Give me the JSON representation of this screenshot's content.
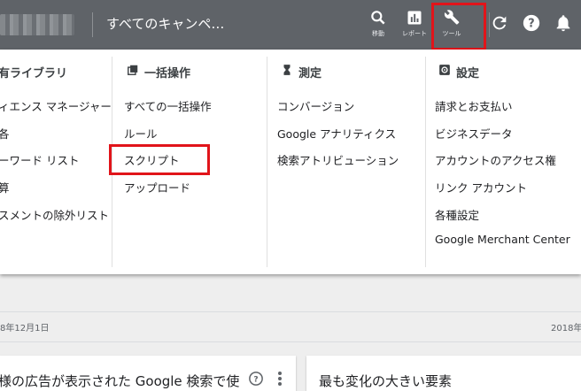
{
  "header": {
    "campaign_title": "すべてのキャンペ…",
    "tools": [
      {
        "icon": "search-icon",
        "label": "移動"
      },
      {
        "icon": "bar-chart-icon",
        "label": "レポート"
      },
      {
        "icon": "wrench-icon",
        "label": "ツール"
      }
    ],
    "icons": [
      "refresh-icon",
      "help-icon",
      "notifications-icon"
    ]
  },
  "menu": {
    "col1": {
      "items": [
        "有ライブラリ",
        "ィエンス マネージャー",
        "各",
        "ーワード リスト",
        "算",
        "スメントの除外リスト"
      ]
    },
    "col2": {
      "header": "一括操作",
      "icon": "bulk-actions-icon",
      "items": [
        "すべての一括操作",
        "ルール",
        "スクリプト",
        "アップロード"
      ]
    },
    "col3": {
      "header": "測定",
      "icon": "hourglass-icon",
      "items": [
        "コンバージョン",
        "Google アナリティクス",
        "検索アトリビューション"
      ]
    },
    "col4": {
      "header": "設定",
      "icon": "settings-icon",
      "items": [
        "請求とお支払い",
        "ビジネスデータ",
        "アカウントのアクセス権",
        "リンク アカウント",
        "各種設定",
        "Google Merchant Center"
      ]
    }
  },
  "date_range": {
    "start": "8年12月1日",
    "end": "2018年"
  },
  "cards": {
    "left_title": "様の広告が表示された Google 検索で使",
    "right_title": "最も変化の大きい要素"
  },
  "colors": {
    "topbar": "#5f6368",
    "highlight": "#e1141a"
  }
}
